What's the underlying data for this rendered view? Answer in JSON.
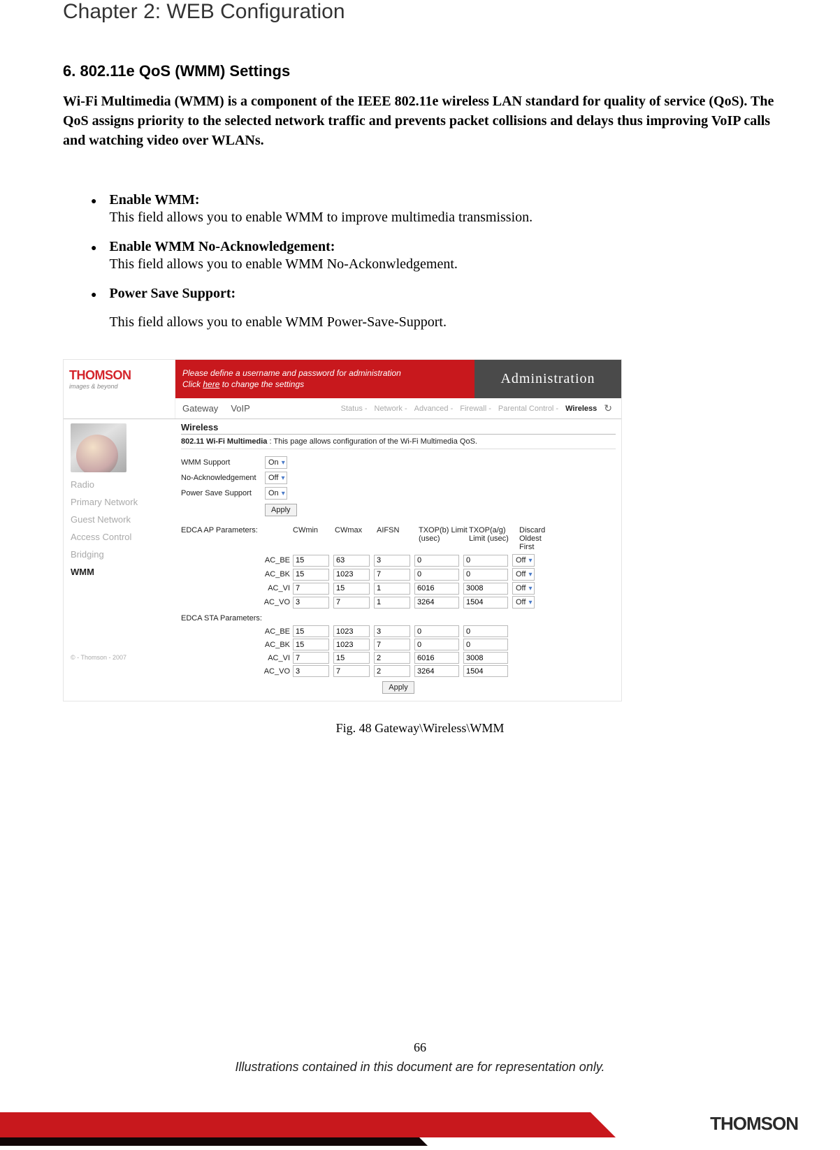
{
  "chapter_title": "Chapter 2: WEB Configuration",
  "section_title": "6. 802.11e QoS (WMM) Settings",
  "intro": "Wi-Fi Multimedia (WMM) is a component of the IEEE 802.11e wireless LAN standard for quality of service (QoS). The QoS assigns priority to the selected network traffic and prevents packet collisions and delays thus improving VoIP calls and watching video over WLANs.",
  "bullets": [
    {
      "title": "Enable WMM:",
      "desc": "This field allows you to enable WMM to improve multimedia transmission.",
      "detached": false
    },
    {
      "title": "Enable WMM No-Acknowledgement:",
      "desc": "This field allows you to enable WMM No-Ackonwledgement.",
      "detached": false
    },
    {
      "title": "Power Save Support:",
      "desc": "This field allows you to enable WMM Power-Save-Support.",
      "detached": true
    }
  ],
  "admin": {
    "logo_brand": "THOMSON",
    "logo_tag": "images & beyond",
    "banner_line1": "Please define a username and password for administration",
    "banner_line2_pre": "Click ",
    "banner_line2_link": "here",
    "banner_line2_post": " to change the settings",
    "right_title": "Administration",
    "tabs_main": [
      "Gateway",
      "VoIP"
    ],
    "tabs_sub": [
      "Status -",
      "Network -",
      "Advanced -",
      "Firewall -",
      "Parental Control -"
    ],
    "active_sub": "Wireless",
    "sidebar": {
      "items": [
        "Radio",
        "Primary Network",
        "Guest Network",
        "Access Control",
        "Bridging",
        "WMM"
      ],
      "active": "WMM",
      "footer": "© - Thomson - 2007"
    },
    "page_heading": "Wireless",
    "page_sub_bold": "802.11 Wi-Fi Multimedia",
    "page_sub_rest": "  :  This page allows configuration of the Wi-Fi Multimedia QoS.",
    "fields": {
      "wmm_support": {
        "label": "WMM Support",
        "value": "On"
      },
      "no_ack": {
        "label": "No-Acknowledgement",
        "value": "Off"
      },
      "pss": {
        "label": "Power Save Support",
        "value": "On"
      },
      "apply": "Apply"
    },
    "edca_ap": {
      "title": "EDCA AP Parameters:",
      "headers": [
        "CWmin",
        "CWmax",
        "AIFSN",
        "TXOP(b) Limit (usec)",
        "TXOP(a/g) Limit (usec)",
        "Discard Oldest First"
      ],
      "rows": [
        {
          "name": "AC_BE",
          "v": [
            "15",
            "63",
            "3",
            "0",
            "0"
          ],
          "d": "Off"
        },
        {
          "name": "AC_BK",
          "v": [
            "15",
            "1023",
            "7",
            "0",
            "0"
          ],
          "d": "Off"
        },
        {
          "name": "AC_VI",
          "v": [
            "7",
            "15",
            "1",
            "6016",
            "3008"
          ],
          "d": "Off"
        },
        {
          "name": "AC_VO",
          "v": [
            "3",
            "7",
            "1",
            "3264",
            "1504"
          ],
          "d": "Off"
        }
      ]
    },
    "edca_sta": {
      "title": "EDCA STA Parameters:",
      "rows": [
        {
          "name": "AC_BE",
          "v": [
            "15",
            "1023",
            "3",
            "0",
            "0"
          ]
        },
        {
          "name": "AC_BK",
          "v": [
            "15",
            "1023",
            "7",
            "0",
            "0"
          ]
        },
        {
          "name": "AC_VI",
          "v": [
            "7",
            "15",
            "2",
            "6016",
            "3008"
          ]
        },
        {
          "name": "AC_VO",
          "v": [
            "3",
            "7",
            "2",
            "3264",
            "1504"
          ]
        }
      ],
      "apply": "Apply"
    }
  },
  "figure_caption": "Fig. 48 Gateway\\Wireless\\WMM",
  "page_number": "66",
  "disclaimer": "Illustrations contained in this document are for representation only.",
  "footer_brand": "THOMSON"
}
